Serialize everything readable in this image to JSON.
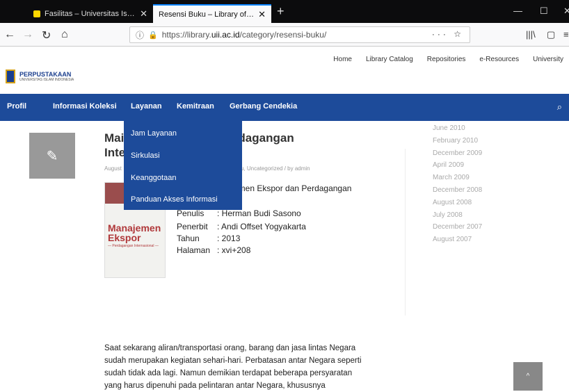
{
  "browser": {
    "tab_inactive": "Fasilitas – Universitas Islam Indo",
    "tab_active": "Resensi Buku – Library of Islamic U",
    "url_prefix": "https://library.",
    "url_host": "uii.ac.id",
    "url_path": "/category/resensi-buku/"
  },
  "top_links": [
    "Home",
    "Library Catalog",
    "Repositories",
    "e-Resources",
    "University"
  ],
  "logo": {
    "title": "PERPUSTAKAAN",
    "subtitle": "UNIVERSITAS ISLAM INDONESIA"
  },
  "main_nav": [
    "Profil",
    "Informasi Koleksi",
    "Layanan",
    "Kemitraan",
    "Gerbang Cendekia"
  ],
  "dropdown": [
    "Jam Layanan",
    "Sirkulasi",
    "Keanggotaan",
    "Panduan Akses Informasi"
  ],
  "post": {
    "title_left1": "Mai",
    "title_right1": "erdagangan",
    "title_left2": "Inte",
    "meta_left": "August",
    "meta_right": "u, Uncategorized  /  by admin",
    "book_title_fragment": "emen Ekspor dan Perdagangan",
    "penulis_label": "Penulis",
    "penulis_value": ": Herman Budi Sasono",
    "penerbit_label": "Penerbit",
    "penerbit_value": ": Andi Offset Yogyakarta",
    "tahun_label": "Tahun",
    "tahun_value": ": 2013",
    "halaman_label": "Halaman",
    "halaman_value": ": xvi+208",
    "cover_title1": "Manajemen",
    "cover_title2": "Ekspor",
    "cover_subtitle": "— Perdagangan Internasional —",
    "paragraph": "Saat sekarang aliran/transportasi orang, barang dan jasa lintas Negara sudah merupakan kegiatan sehari-hari. Perbatasan antar Negara seperti sudah tidak ada lagi. Namun demikian terdapat beberapa persyaratan yang harus dipenuhi pada pelintaran antar Negara, khususnya"
  },
  "archives": [
    "June 2010",
    "February 2010",
    "December 2009",
    "April 2009",
    "March 2009",
    "December 2008",
    "August 2008",
    "July 2008",
    "December 2007",
    "August 2007"
  ]
}
